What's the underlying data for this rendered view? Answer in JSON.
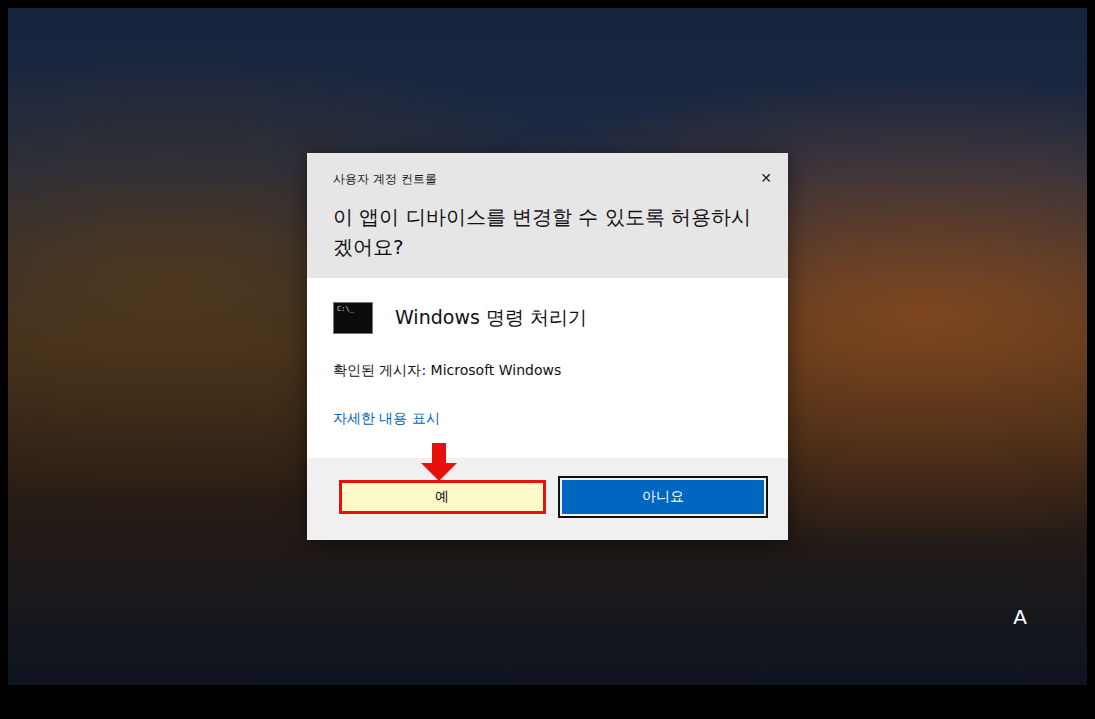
{
  "window": {
    "title": "사용자 계정 컨트롤",
    "close": "✕"
  },
  "question": "이 앱이 디바이스를 변경할 수 있도록 허용하시겠어요?",
  "app": {
    "name": "Windows 명령 처리기",
    "icon_text": "C:\\_"
  },
  "publisher": "확인된 게시자: Microsoft Windows",
  "details_link": "자세한 내용 표시",
  "buttons": [
    {
      "label": "예",
      "highlighted": true,
      "default": false
    },
    {
      "label": "아니요",
      "highlighted": false,
      "default": true
    }
  ],
  "ime_indicator": "A"
}
